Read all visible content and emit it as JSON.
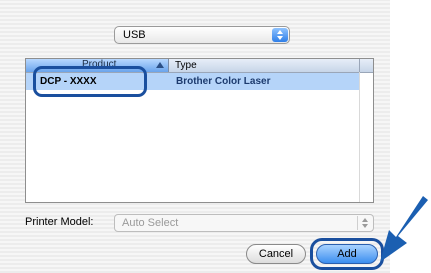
{
  "connection": {
    "selected": "USB"
  },
  "printer_list": {
    "columns": {
      "product": "Product",
      "type": "Type"
    },
    "rows": [
      {
        "product": "DCP - XXXX",
        "type": "Brother Color Laser",
        "selected": true
      }
    ]
  },
  "printer_model": {
    "label": "Printer Model:",
    "value": "Auto Select"
  },
  "buttons": {
    "cancel": "Cancel",
    "add": "Add"
  },
  "colors": {
    "accent_blue": "#3c8eef",
    "highlight_ring": "#1a4f9e",
    "selection": "#b5d4f9",
    "pointer_arrow": "#1b5fb1"
  }
}
